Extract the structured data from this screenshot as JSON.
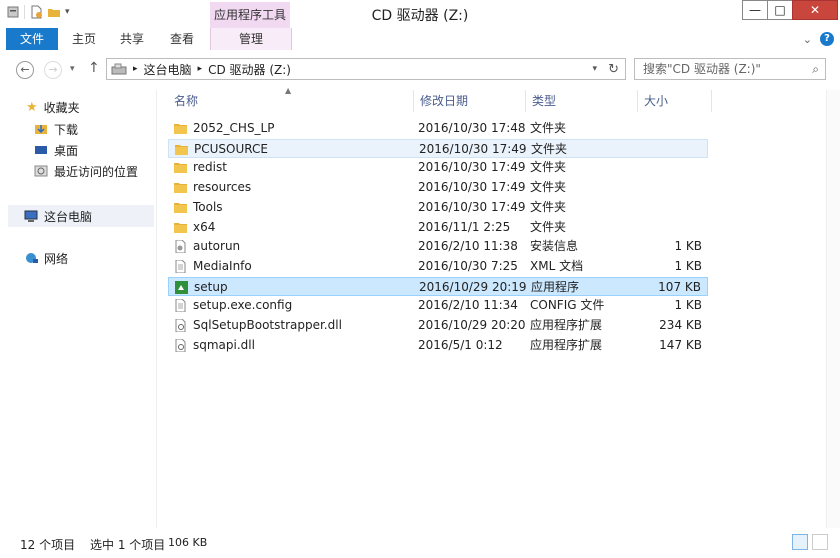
{
  "window": {
    "title": "CD 驱动器 (Z:)",
    "contextual_group": "应用程序工具",
    "controls": {
      "minimize": "—",
      "maximize": "□",
      "close": "✕"
    }
  },
  "ribbon": {
    "file_tab": "文件",
    "tabs": [
      "主页",
      "共享",
      "查看",
      "管理"
    ]
  },
  "navigation": {
    "breadcrumb": [
      "这台电脑",
      "CD 驱动器 (Z:)"
    ],
    "search_placeholder": "搜索\"CD 驱动器 (Z:)\""
  },
  "nav_pane": {
    "favorites": "收藏夹",
    "favorite_items": [
      "下载",
      "桌面",
      "最近访问的位置"
    ],
    "this_pc": "这台电脑",
    "network": "网络"
  },
  "columns": {
    "name": "名称",
    "modified": "修改日期",
    "type": "类型",
    "size": "大小"
  },
  "files": [
    {
      "name": "2052_CHS_LP",
      "modified": "2016/10/30 17:48",
      "type": "文件夹",
      "size": "",
      "icon": "folder-icon"
    },
    {
      "name": "PCUSOURCE",
      "modified": "2016/10/30 17:49",
      "type": "文件夹",
      "size": "",
      "icon": "folder-icon"
    },
    {
      "name": "redist",
      "modified": "2016/10/30 17:49",
      "type": "文件夹",
      "size": "",
      "icon": "folder-icon"
    },
    {
      "name": "resources",
      "modified": "2016/10/30 17:49",
      "type": "文件夹",
      "size": "",
      "icon": "folder-icon"
    },
    {
      "name": "Tools",
      "modified": "2016/10/30 17:49",
      "type": "文件夹",
      "size": "",
      "icon": "folder-icon"
    },
    {
      "name": "x64",
      "modified": "2016/11/1 2:25",
      "type": "文件夹",
      "size": "",
      "icon": "folder-icon"
    },
    {
      "name": "autorun",
      "modified": "2016/2/10 11:38",
      "type": "安装信息",
      "size": "1 KB",
      "icon": "setup-info-icon"
    },
    {
      "name": "MediaInfo",
      "modified": "2016/10/30 7:25",
      "type": "XML 文档",
      "size": "1 KB",
      "icon": "document-icon"
    },
    {
      "name": "setup",
      "modified": "2016/10/29 20:19",
      "type": "应用程序",
      "size": "107 KB",
      "icon": "application-icon"
    },
    {
      "name": "setup.exe.config",
      "modified": "2016/2/10 11:34",
      "type": "CONFIG 文件",
      "size": "1 KB",
      "icon": "document-icon"
    },
    {
      "name": "SqlSetupBootstrapper.dll",
      "modified": "2016/10/29 20:20",
      "type": "应用程序扩展",
      "size": "234 KB",
      "icon": "dll-icon"
    },
    {
      "name": "sqmapi.dll",
      "modified": "2016/5/1 0:12",
      "type": "应用程序扩展",
      "size": "147 KB",
      "icon": "dll-icon"
    }
  ],
  "status": {
    "item_count": "12 个项目",
    "selection": "选中 1 个项目",
    "selection_size": "106 KB"
  },
  "colors": {
    "file_tab": "#1979ca",
    "contextual_tab": "#f2d9f2",
    "selected_row": "#cce8ff",
    "folder": "#e8b33a"
  }
}
